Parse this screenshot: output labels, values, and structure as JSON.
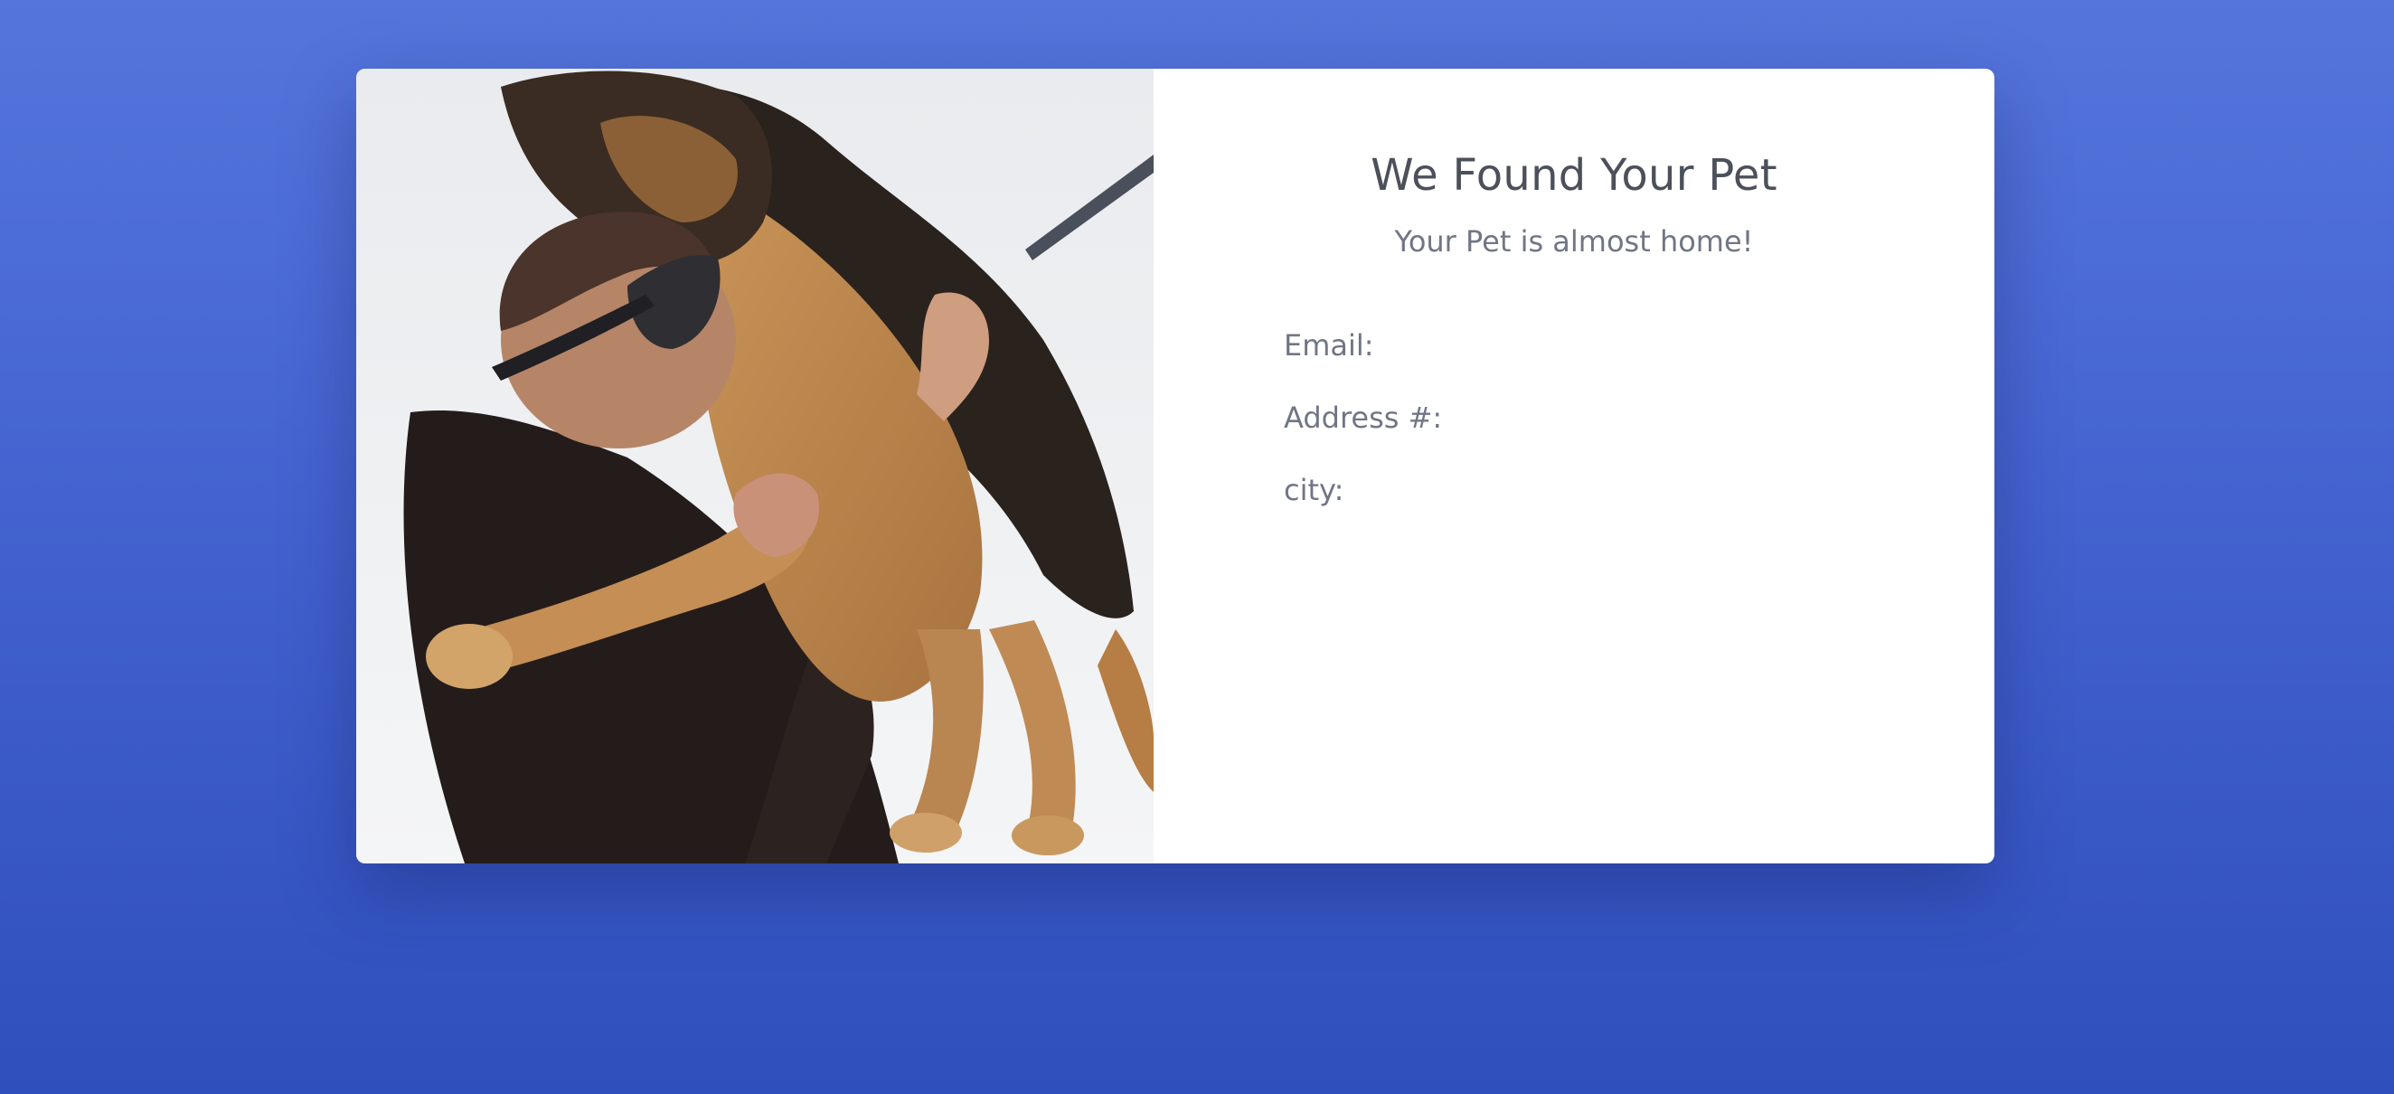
{
  "card": {
    "title": "We Found Your Pet",
    "subtitle": "Your Pet is almost home!",
    "photo_alt": "Man hugging a German Shepherd dog in the snow",
    "fields": [
      {
        "label": "Email:",
        "value": ""
      },
      {
        "label": "Address #:",
        "value": ""
      },
      {
        "label": "city:",
        "value": ""
      }
    ]
  },
  "colors": {
    "background_top": "#5575dc",
    "background_bottom": "#2f4fbd",
    "card": "#ffffff",
    "title_text": "#4c505b",
    "label_text": "#707684"
  }
}
